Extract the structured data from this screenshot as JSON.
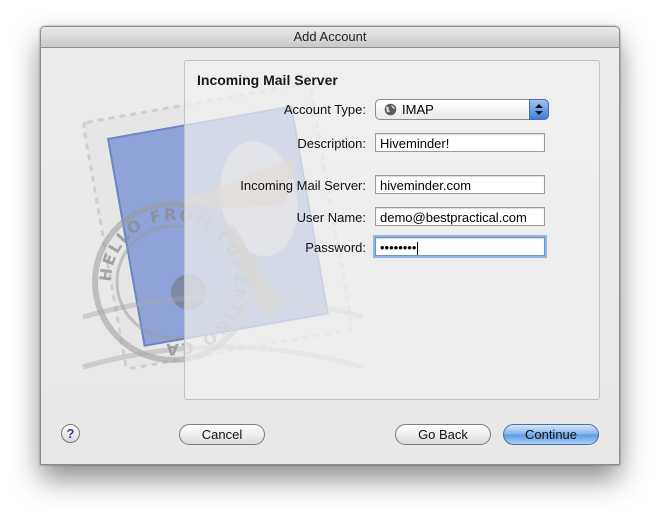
{
  "window": {
    "title": "Add Account"
  },
  "section": {
    "title": "Incoming Mail Server"
  },
  "fields": {
    "account_type": {
      "label": "Account Type:",
      "value": "IMAP",
      "icon": "globe-icon"
    },
    "description": {
      "label": "Description:",
      "value": "Hiveminder!"
    },
    "server": {
      "label": "Incoming Mail Server:",
      "value": "hiveminder.com"
    },
    "username": {
      "label": "User Name:",
      "value": "demo@bestpractical.com"
    },
    "password": {
      "label": "Password:",
      "value": "••••••••"
    }
  },
  "stamp": {
    "text": "HELLO FROM CUPERTINO CA"
  },
  "buttons": {
    "help": "?",
    "cancel": "Cancel",
    "go_back": "Go Back",
    "continue": "Continue"
  },
  "colors": {
    "accent": "#5d9ae3",
    "focus_ring": "#92b6e6",
    "help_glyph": "#5a2ca0"
  }
}
